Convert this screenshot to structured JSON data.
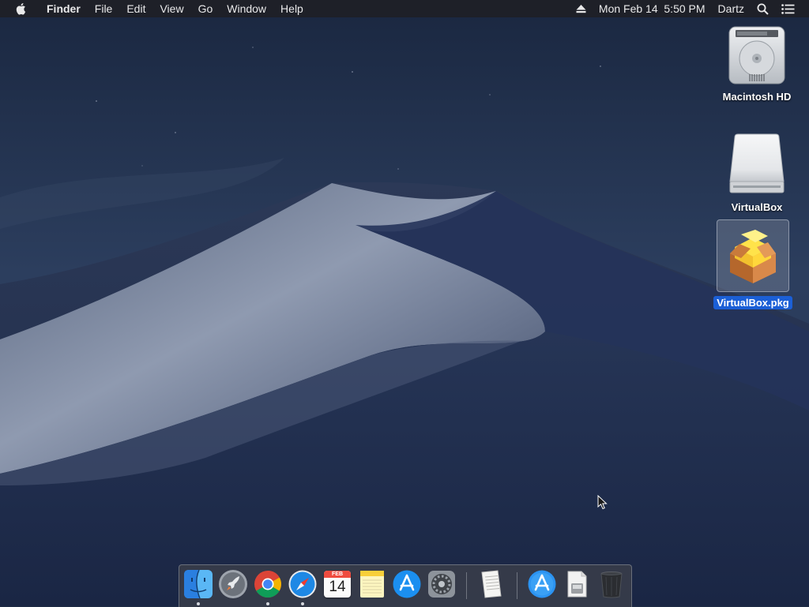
{
  "menubar": {
    "app_name": "Finder",
    "menus": [
      "File",
      "Edit",
      "View",
      "Go",
      "Window",
      "Help"
    ],
    "clock": "Mon Feb 14  5:50 PM",
    "user": "Dartz"
  },
  "desktop": {
    "icons": [
      {
        "label": "Macintosh HD",
        "icon": "hard-drive-icon"
      },
      {
        "label": "VirtualBox",
        "icon": "mounted-disk-icon"
      },
      {
        "label": "VirtualBox.pkg",
        "icon": "package-icon",
        "selected": true
      }
    ]
  },
  "dock": {
    "apps": [
      {
        "name": "Finder",
        "running": true
      },
      {
        "name": "Launchpad",
        "running": false
      },
      {
        "name": "Google Chrome",
        "running": true
      },
      {
        "name": "Safari",
        "running": true
      },
      {
        "name": "Calendar",
        "running": false,
        "month": "FEB",
        "day": "14"
      },
      {
        "name": "Notes",
        "running": false
      },
      {
        "name": "App Store",
        "running": false
      },
      {
        "name": "System Preferences",
        "running": false
      },
      {
        "name": "TextEdit Document",
        "running": false
      },
      {
        "name": "Applications",
        "running": false
      },
      {
        "name": "Downloads",
        "running": false
      },
      {
        "name": "Trash",
        "running": false
      }
    ]
  },
  "colors": {
    "menubar": "#1e2026",
    "selection": "#1b5fd6",
    "sky": "#1f2c45"
  }
}
